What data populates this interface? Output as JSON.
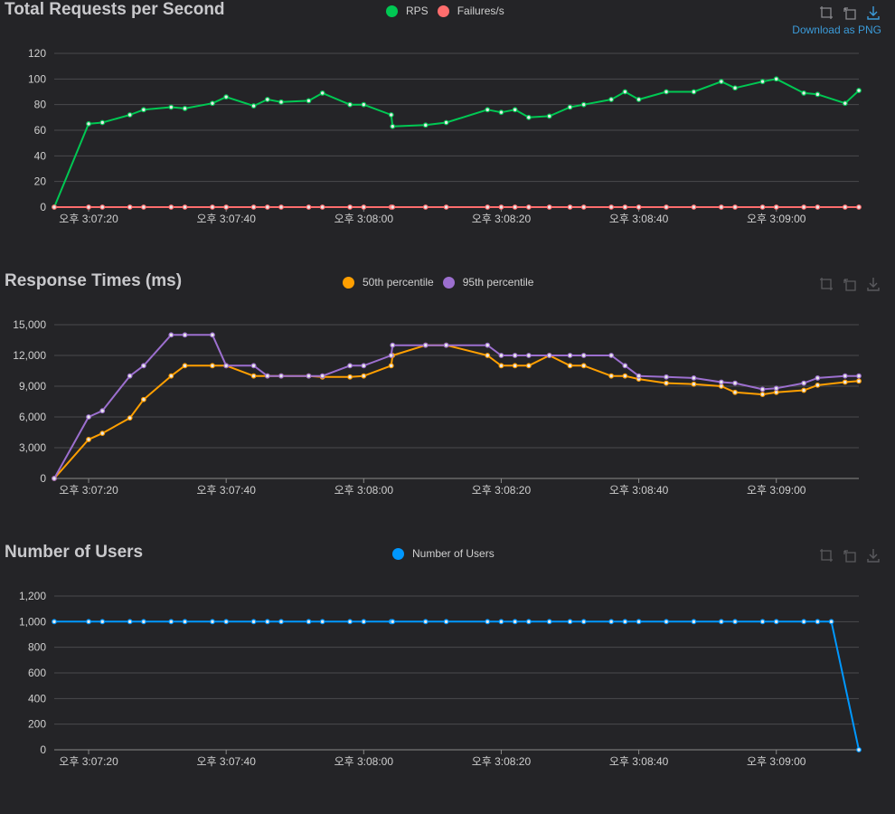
{
  "colors": {
    "background": "#242427",
    "grid": "#4a4a4d",
    "axis": "#8a8a8a",
    "text": "#cfcfcf",
    "rps": "#00c853",
    "failures": "#ff6d6d",
    "p50": "#ff9f00",
    "p95": "#9c6fcf",
    "users": "#0098ff",
    "download": "#3b9bd9"
  },
  "icons": [
    "zoom-icon",
    "zoom-reset-icon",
    "download-icon"
  ],
  "download_label": "Download as PNG",
  "chart_data": [
    {
      "type": "line",
      "title": "Total Requests per Second",
      "x_unit": "time",
      "x": [
        "3:07:15",
        "3:07:20",
        "3:07:22",
        "3:07:26",
        "3:07:28",
        "3:07:32",
        "3:07:34",
        "3:07:38",
        "3:07:40",
        "3:07:44",
        "3:07:46",
        "3:07:48",
        "3:07:52",
        "3:07:54",
        "3:07:58",
        "3:08:00",
        "3:08:04",
        "3:08:04.2",
        "3:08:09",
        "3:08:12",
        "3:08:18",
        "3:08:20",
        "3:08:22",
        "3:08:24",
        "3:08:27",
        "3:08:30",
        "3:08:32",
        "3:08:36",
        "3:08:38",
        "3:08:40",
        "3:08:44",
        "3:08:48",
        "3:08:52",
        "3:08:54",
        "3:08:58",
        "3:09:00",
        "3:09:04",
        "3:09:06",
        "3:09:10",
        "3:09:12"
      ],
      "xticks": [
        "오후 3:07:20",
        "오후 3:07:40",
        "오후 3:08:00",
        "오후 3:08:20",
        "오후 3:08:40",
        "오후 3:09:00"
      ],
      "ylim": [
        0,
        120
      ],
      "yticks": [
        "0",
        "20",
        "40",
        "60",
        "80",
        "100",
        "120"
      ],
      "legend_position": "top-center",
      "grid": true,
      "series": [
        {
          "name": "RPS",
          "color": "#00c853",
          "values": [
            0,
            65,
            66,
            72,
            76,
            78,
            77,
            81,
            86,
            79,
            84,
            82,
            83,
            89,
            80,
            80,
            72,
            63,
            64,
            66,
            76,
            74,
            76,
            70,
            71,
            78,
            80,
            84,
            90,
            84,
            90,
            90,
            98,
            93,
            98,
            100,
            89,
            88,
            81,
            91
          ]
        },
        {
          "name": "Failures/s",
          "color": "#ff6d6d",
          "values": [
            0,
            0,
            0,
            0,
            0,
            0,
            0,
            0,
            0,
            0,
            0,
            0,
            0,
            0,
            0,
            0,
            0,
            0,
            0,
            0,
            0,
            0,
            0,
            0,
            0,
            0,
            0,
            0,
            0,
            0,
            0,
            0,
            0,
            0,
            0,
            0,
            0,
            0,
            0,
            0
          ]
        }
      ]
    },
    {
      "type": "line",
      "title": "Response Times (ms)",
      "x_unit": "time",
      "x": [
        "3:07:15",
        "3:07:20",
        "3:07:22",
        "3:07:26",
        "3:07:28",
        "3:07:32",
        "3:07:34",
        "3:07:38",
        "3:07:40",
        "3:07:44",
        "3:07:46",
        "3:07:48",
        "3:07:52",
        "3:07:54",
        "3:07:58",
        "3:08:00",
        "3:08:04",
        "3:08:04.2",
        "3:08:09",
        "3:08:12",
        "3:08:18",
        "3:08:20",
        "3:08:22",
        "3:08:24",
        "3:08:27",
        "3:08:30",
        "3:08:32",
        "3:08:36",
        "3:08:38",
        "3:08:40",
        "3:08:44",
        "3:08:48",
        "3:08:52",
        "3:08:54",
        "3:08:58",
        "3:09:00",
        "3:09:04",
        "3:09:06",
        "3:09:10",
        "3:09:12"
      ],
      "xticks": [
        "오후 3:07:20",
        "오후 3:07:40",
        "오후 3:08:00",
        "오후 3:08:20",
        "오후 3:08:40",
        "오후 3:09:00"
      ],
      "ylim": [
        0,
        15000
      ],
      "yticks": [
        "0",
        "3,000",
        "6,000",
        "9,000",
        "12,000",
        "15,000"
      ],
      "legend_position": "top-center",
      "grid": true,
      "series": [
        {
          "name": "50th percentile",
          "color": "#ff9f00",
          "values": [
            0,
            3800,
            4400,
            5900,
            7700,
            10000,
            11000,
            11000,
            11000,
            10000,
            10000,
            10000,
            10000,
            9900,
            9900,
            10000,
            11000,
            12000,
            13000,
            13000,
            12000,
            11000,
            11000,
            11000,
            12000,
            11000,
            11000,
            10000,
            10000,
            9700,
            9300,
            9200,
            9000,
            8400,
            8200,
            8400,
            8600,
            9100,
            9400,
            9500
          ]
        },
        {
          "name": "95th percentile",
          "color": "#9c6fcf",
          "values": [
            0,
            6000,
            6600,
            10000,
            11000,
            14000,
            14000,
            14000,
            11000,
            11000,
            10000,
            10000,
            10000,
            10000,
            11000,
            11000,
            12000,
            13000,
            13000,
            13000,
            13000,
            12000,
            12000,
            12000,
            12000,
            12000,
            12000,
            12000,
            11000,
            10000,
            9900,
            9800,
            9400,
            9300,
            8700,
            8800,
            9300,
            9800,
            10000,
            10000
          ]
        }
      ]
    },
    {
      "type": "line",
      "title": "Number of Users",
      "x_unit": "time",
      "x": [
        "3:07:15",
        "3:07:20",
        "3:07:22",
        "3:07:26",
        "3:07:28",
        "3:07:32",
        "3:07:34",
        "3:07:38",
        "3:07:40",
        "3:07:44",
        "3:07:46",
        "3:07:48",
        "3:07:52",
        "3:07:54",
        "3:07:58",
        "3:08:00",
        "3:08:04",
        "3:08:04.2",
        "3:08:09",
        "3:08:12",
        "3:08:18",
        "3:08:20",
        "3:08:22",
        "3:08:24",
        "3:08:27",
        "3:08:30",
        "3:08:32",
        "3:08:36",
        "3:08:38",
        "3:08:40",
        "3:08:44",
        "3:08:48",
        "3:08:52",
        "3:08:54",
        "3:08:58",
        "3:09:00",
        "3:09:04",
        "3:09:06",
        "3:09:08",
        "3:09:12"
      ],
      "xticks": [
        "오후 3:07:20",
        "오후 3:07:40",
        "오후 3:08:00",
        "오후 3:08:20",
        "오후 3:08:40",
        "오후 3:09:00"
      ],
      "ylim": [
        0,
        1200
      ],
      "yticks": [
        "0",
        "200",
        "400",
        "600",
        "800",
        "1,000",
        "1,200"
      ],
      "legend_position": "top-center",
      "grid": true,
      "series": [
        {
          "name": "Number of Users",
          "color": "#0098ff",
          "values": [
            1000,
            1000,
            1000,
            1000,
            1000,
            1000,
            1000,
            1000,
            1000,
            1000,
            1000,
            1000,
            1000,
            1000,
            1000,
            1000,
            1000,
            1000,
            1000,
            1000,
            1000,
            1000,
            1000,
            1000,
            1000,
            1000,
            1000,
            1000,
            1000,
            1000,
            1000,
            1000,
            1000,
            1000,
            1000,
            1000,
            1000,
            1000,
            1000,
            0
          ]
        }
      ]
    }
  ]
}
